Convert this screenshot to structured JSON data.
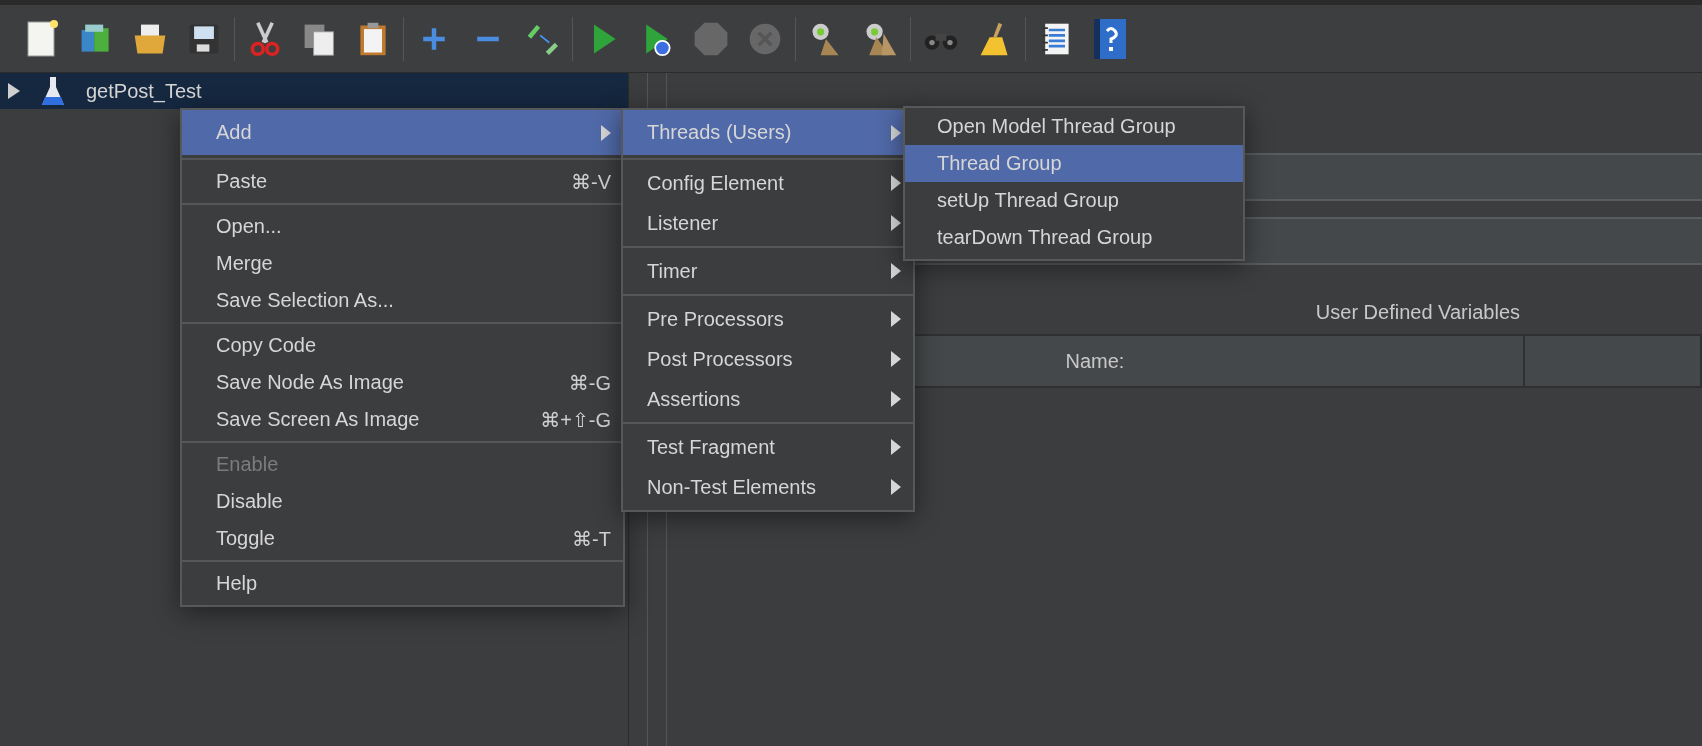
{
  "toolbar_groups": [
    [
      {
        "disabled": false
      },
      {
        "disabled": false
      },
      {
        "disabled": false
      },
      {
        "disabled": false
      }
    ],
    [
      {
        "disabled": false
      },
      {
        "disabled": false
      },
      {
        "disabled": false
      }
    ],
    [
      {
        "disabled": false
      },
      {
        "disabled": false
      },
      {
        "disabled": false
      }
    ],
    [
      {
        "disabled": false
      },
      {
        "disabled": false
      },
      {
        "disabled": true
      },
      {
        "disabled": true
      }
    ],
    [
      {
        "disabled": false
      },
      {
        "disabled": false
      }
    ],
    [
      {
        "disabled": false
      },
      {
        "disabled": false
      }
    ],
    [
      {
        "disabled": false
      },
      {
        "disabled": false
      }
    ]
  ],
  "tree": {
    "items": [
      {
        "label": "getPost_Test",
        "selected": true,
        "expanded": false
      }
    ]
  },
  "context_menu": {
    "sections": [
      [
        {
          "label": "Add",
          "has_submenu": true,
          "selected": true,
          "disabled": false
        }
      ],
      [
        {
          "label": "Paste",
          "shortcut": "⌘-V",
          "has_submenu": false,
          "selected": false,
          "disabled": false
        }
      ],
      [
        {
          "label": "Open...",
          "has_submenu": false,
          "selected": false,
          "disabled": false
        },
        {
          "label": "Merge",
          "has_submenu": false,
          "selected": false,
          "disabled": false
        },
        {
          "label": "Save Selection As...",
          "has_submenu": false,
          "selected": false,
          "disabled": false
        }
      ],
      [
        {
          "label": "Copy Code",
          "has_submenu": false,
          "selected": false,
          "disabled": false
        },
        {
          "label": "Save Node As Image",
          "shortcut": "⌘-G",
          "has_submenu": false,
          "selected": false,
          "disabled": false
        },
        {
          "label": "Save Screen As Image",
          "shortcut": "⌘+⇧-G",
          "has_submenu": false,
          "selected": false,
          "disabled": false
        }
      ],
      [
        {
          "label": "Enable",
          "has_submenu": false,
          "selected": false,
          "disabled": true
        },
        {
          "label": "Disable",
          "has_submenu": false,
          "selected": false,
          "disabled": false
        },
        {
          "label": "Toggle",
          "shortcut": "⌘-T",
          "has_submenu": false,
          "selected": false,
          "disabled": false
        }
      ],
      [
        {
          "label": "Help",
          "has_submenu": false,
          "selected": false,
          "disabled": false
        }
      ]
    ]
  },
  "add_submenu": {
    "sections": [
      [
        {
          "label": "Threads (Users)",
          "has_submenu": true,
          "selected": true,
          "disabled": false
        }
      ],
      [
        {
          "label": "Config Element",
          "has_submenu": true,
          "selected": false,
          "disabled": false
        },
        {
          "label": "Listener",
          "has_submenu": true,
          "selected": false,
          "disabled": false
        }
      ],
      [
        {
          "label": "Timer",
          "has_submenu": true,
          "selected": false,
          "disabled": false
        }
      ],
      [
        {
          "label": "Pre Processors",
          "has_submenu": true,
          "selected": false,
          "disabled": false
        },
        {
          "label": "Post Processors",
          "has_submenu": true,
          "selected": false,
          "disabled": false
        },
        {
          "label": "Assertions",
          "has_submenu": true,
          "selected": false,
          "disabled": false
        }
      ],
      [
        {
          "label": "Test Fragment",
          "has_submenu": true,
          "selected": false,
          "disabled": false
        },
        {
          "label": "Non-Test Elements",
          "has_submenu": true,
          "selected": false,
          "disabled": false
        }
      ]
    ]
  },
  "threads_submenu": {
    "sections": [
      [
        {
          "label": "Open Model Thread Group",
          "has_submenu": false,
          "selected": false,
          "disabled": false
        },
        {
          "label": "Thread Group",
          "has_submenu": false,
          "selected": true,
          "disabled": false
        },
        {
          "label": "setUp Thread Group",
          "has_submenu": false,
          "selected": false,
          "disabled": false
        },
        {
          "label": "tearDown Thread Group",
          "has_submenu": false,
          "selected": false,
          "disabled": false
        }
      ]
    ]
  },
  "editor": {
    "section_title": "User Defined Variables",
    "table": {
      "columns": [
        "Name:"
      ]
    }
  }
}
